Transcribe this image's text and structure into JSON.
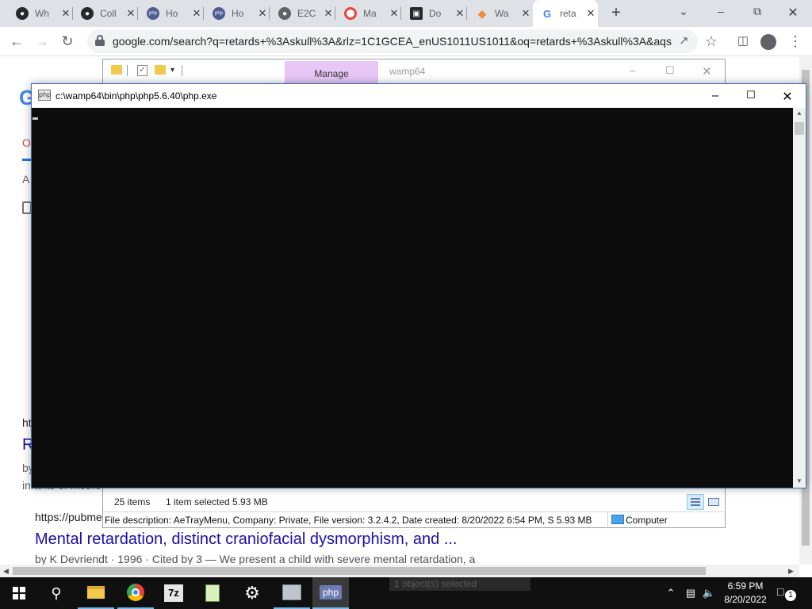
{
  "browser": {
    "tabs": [
      {
        "label": "Wh",
        "favicon": "github-icon",
        "color": "#24292f",
        "glyph": "●"
      },
      {
        "label": "Coll",
        "favicon": "github-icon",
        "color": "#24292f",
        "glyph": "●"
      },
      {
        "label": "Ho",
        "favicon": "php-icon",
        "color": "#4f5b93",
        "glyph": "php"
      },
      {
        "label": "Ho",
        "favicon": "php-icon",
        "color": "#4f5b93",
        "glyph": "php"
      },
      {
        "label": "E2C",
        "favicon": "globe-icon",
        "color": "#5f6368",
        "glyph": "●"
      },
      {
        "label": "Ma",
        "favicon": "ring-icon",
        "color": "#e8453c",
        "glyph": "○"
      },
      {
        "label": "Do",
        "favicon": "download-icon",
        "color": "#24292f",
        "glyph": "▣"
      },
      {
        "label": "Wa",
        "favicon": "diamond-icon",
        "color": "#f28b3a",
        "glyph": "◆"
      },
      {
        "label": "reta",
        "favicon": "google-icon",
        "color": "#4285f4",
        "glyph": "G"
      }
    ],
    "tab_close_glyph": "✕",
    "new_tab_glyph": "+",
    "url": "google.com/search?q=retards+%3Askull%3A&rlz=1C1GCEA_enUS1011US1011&oq=retards+%3Askull%3A&aqs..."
  },
  "google": {
    "fragments": {
      "a": "A",
      "o": "O",
      "ht": "ht",
      "r": "R",
      "by": "by",
      "infants": "infants of mothe"
    },
    "result": {
      "url": "https://pubme",
      "title": "Mental retardation, distinct craniofacial dysmorphism, and ...",
      "meta": "by K Devriendt · 1996 · Cited by 3 — We present a child with severe mental retardation, a"
    }
  },
  "explorer": {
    "tab": "Manage",
    "title": "wamp64",
    "status": {
      "items": "25 items",
      "selected": "1 item selected  5.93 MB"
    },
    "details": "File description: AeTrayMenu, Company: Private, File version: 3.2.4.2, Date created: 8/20/2022 6:54 PM, S 5.93 MB",
    "location": "Computer"
  },
  "console": {
    "title": "c:\\wamp64\\bin\\php\\php5.6.40\\php.exe",
    "icon_text": "php"
  },
  "taskbar": {
    "ghost_text": "1 object(s) selected",
    "php_label": "php",
    "zip_label": "7z",
    "time": "6:59 PM",
    "date": "8/20/2022",
    "notif_count": "1"
  }
}
